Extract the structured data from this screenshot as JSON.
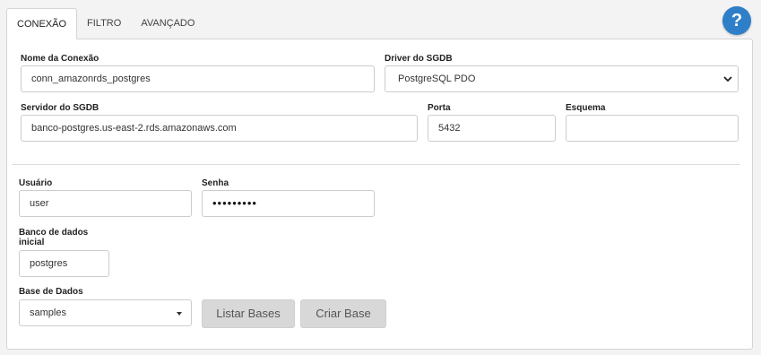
{
  "tabs": [
    {
      "label": "CONEXÃO",
      "active": true
    },
    {
      "label": "FILTRO",
      "active": false
    },
    {
      "label": "AVANÇADO",
      "active": false
    }
  ],
  "help": {
    "label": "?"
  },
  "form": {
    "connection_name": {
      "label": "Nome da Conexão",
      "value": "conn_amazonrds_postgres"
    },
    "driver": {
      "label": "Driver do SGDB",
      "value": "PostgreSQL PDO"
    },
    "server": {
      "label": "Servidor do SGDB",
      "value": "banco-postgres.us-east-2.rds.amazonaws.com"
    },
    "port": {
      "label": "Porta",
      "value": "5432"
    },
    "schema": {
      "label": "Esquema",
      "value": ""
    },
    "user": {
      "label": "Usuário",
      "value": "user"
    },
    "password": {
      "label": "Senha",
      "value": "•••••••••"
    },
    "initial_db": {
      "label_line1": "Banco de dados",
      "label_line2": "inicial",
      "value": "postgres"
    },
    "database": {
      "label": "Base de Dados",
      "value": "samples"
    }
  },
  "buttons": {
    "list_bases": "Listar Bases",
    "create_base": "Criar Base"
  },
  "colors": {
    "accent": "#2f7fc8",
    "button_bg": "#d8d8d8"
  }
}
